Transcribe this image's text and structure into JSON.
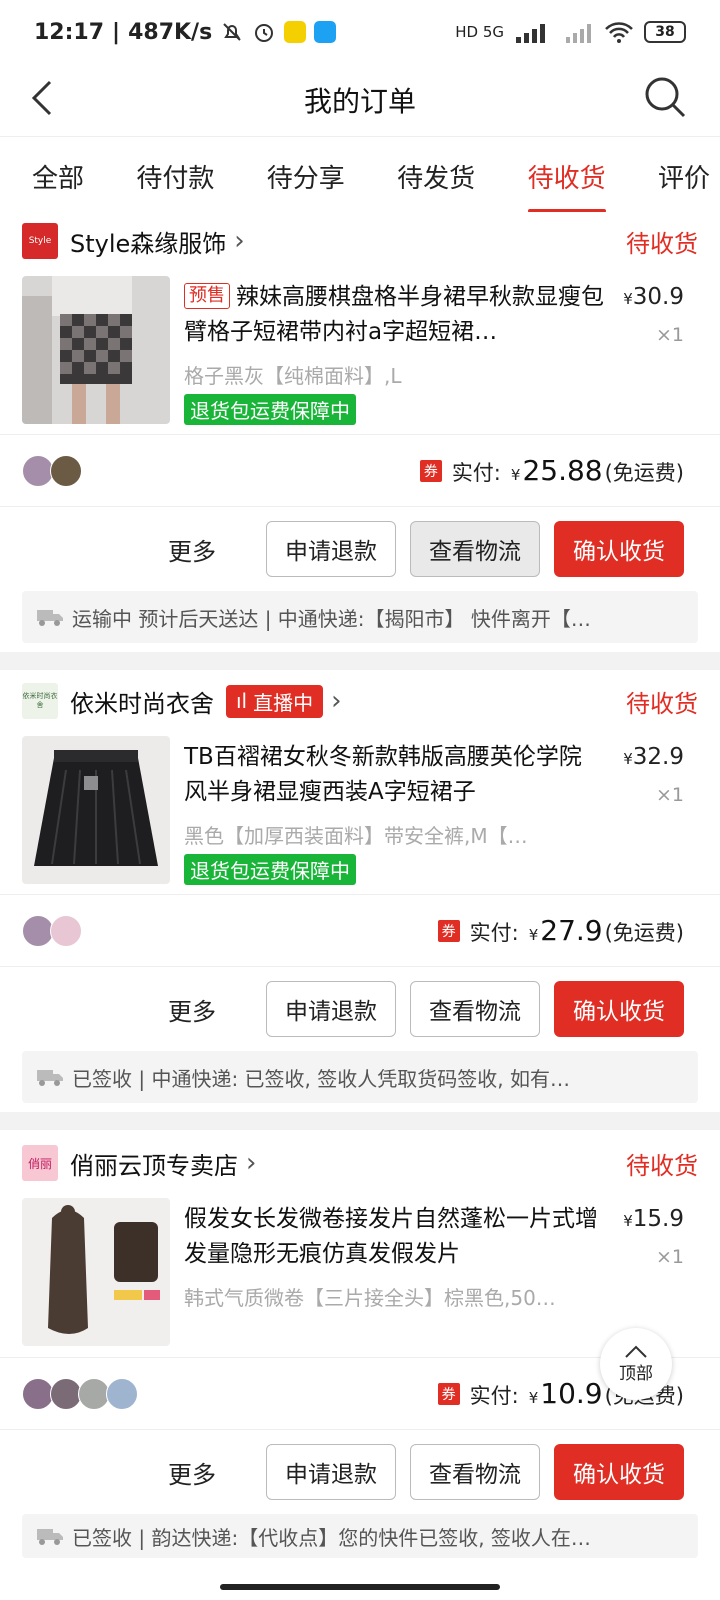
{
  "status_bar": {
    "time": "12:17",
    "speed": "487K/s",
    "net": "HD 5G",
    "battery": "38"
  },
  "header": {
    "title": "我的订单"
  },
  "tabs": [
    {
      "label": "全部",
      "active": false
    },
    {
      "label": "待付款",
      "active": false
    },
    {
      "label": "待分享",
      "active": false
    },
    {
      "label": "待发货",
      "active": false
    },
    {
      "label": "待收货",
      "active": true
    },
    {
      "label": "评价",
      "active": false
    }
  ],
  "orders": [
    {
      "shop": "Style森缘服饰",
      "shop_logo_text": "Style",
      "status": "待收货",
      "presale": "预售",
      "title": "辣妹高腰棋盘格半身裙早秋款显瘦包臂格子短裙带内衬a字超短裙…",
      "price": "30.9",
      "currency": "¥",
      "qty": "×1",
      "spec": "格子黑灰【纯棉面料】,L",
      "guarantee": "退货包运费保障中",
      "coupon": "券",
      "pay_label": "实付:",
      "pay_amount": "25.88",
      "shipping_note": "(免运费)",
      "more": "更多",
      "btn_refund": "申请退款",
      "btn_logistics": "查看物流",
      "btn_confirm": "确认收货",
      "logistics": "运输中 预计后天送达 | 中通快递:【揭阳市】 快件离开【…"
    },
    {
      "shop": "依米时尚衣舍",
      "shop_logo_text": "依米时尚衣舍",
      "live_badge": "直播中",
      "status": "待收货",
      "title": "TB百褶裙女秋冬新款韩版高腰英伦学院风半身裙显瘦西装A字短裙子",
      "price": "32.9",
      "currency": "¥",
      "qty": "×1",
      "spec": "黑色【加厚西装面料】带安全裤,M【…",
      "guarantee": "退货包运费保障中",
      "coupon": "券",
      "pay_label": "实付:",
      "pay_amount": "27.9",
      "shipping_note": "(免运费)",
      "more": "更多",
      "btn_refund": "申请退款",
      "btn_logistics": "查看物流",
      "btn_confirm": "确认收货",
      "logistics": "已签收 | 中通快递: 已签收, 签收人凭取货码签收, 如有…"
    },
    {
      "shop": "俏丽云顶专卖店",
      "shop_logo_text": "俏丽",
      "status": "待收货",
      "title": "假发女长发微卷接发片自然蓬松一片式增发量隐形无痕仿真发假发片",
      "price": "15.9",
      "currency": "¥",
      "qty": "×1",
      "spec": "韩式气质微卷【三片接全头】棕黑色,50…",
      "coupon": "券",
      "pay_label": "实付:",
      "pay_amount": "10.9",
      "shipping_note": "(免运费)",
      "more": "更多",
      "btn_refund": "申请退款",
      "btn_logistics": "查看物流",
      "btn_confirm": "确认收货",
      "logistics": "已签收 | 韵达快递:【代收点】您的快件已签收, 签收人在…"
    }
  ],
  "top_button": "顶部",
  "colors": {
    "accent": "#e02e24",
    "guarantee": "#19b538"
  }
}
